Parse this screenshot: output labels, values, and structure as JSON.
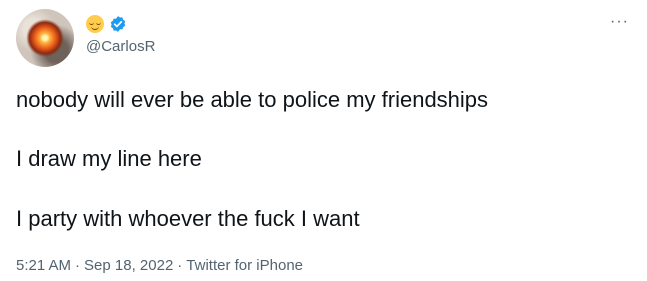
{
  "tweet": {
    "handle": "@CarlosR",
    "more_label": "···",
    "lines": [
      "nobody will ever be able to police my friendships",
      "I draw my line here",
      "I party with whoever the fuck I want"
    ],
    "time": "5:21 AM",
    "date": "Sep 18, 2022",
    "client": "Twitter for iPhone",
    "separator": "·"
  },
  "icons": {
    "name_emoji": "relieved-face-emoji-icon",
    "verified": "verified-badge-icon",
    "more": "more-options-icon"
  },
  "colors": {
    "text": "#0f1419",
    "secondary": "#536471",
    "verified": "#1d9bf0"
  }
}
